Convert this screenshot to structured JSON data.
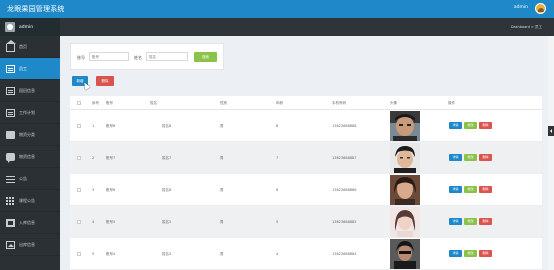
{
  "app": {
    "title": "龙眼果园管理系统",
    "user_name": "admin"
  },
  "sidebar": {
    "user_label": "admin",
    "items": [
      {
        "label": "首页",
        "icon": "home-icon"
      },
      {
        "label": "员工",
        "icon": "document-icon",
        "active": true
      },
      {
        "label": "园田信息",
        "icon": "document-icon"
      },
      {
        "label": "工作计划",
        "icon": "document-icon"
      },
      {
        "label": "物资分类",
        "icon": "bag-icon"
      },
      {
        "label": "物资信息",
        "icon": "chat-icon"
      },
      {
        "label": "公告",
        "icon": "list-icon"
      },
      {
        "label": "课程公告",
        "icon": "grid-icon"
      },
      {
        "label": "入库信息",
        "icon": "film-icon"
      },
      {
        "label": "出库信息",
        "icon": "image-icon"
      }
    ]
  },
  "breadcrumb": "Dashboard > 员工",
  "search": {
    "account_label": "账号",
    "account_placeholder": "账号",
    "name_label": "姓名",
    "name_placeholder": "姓名",
    "button": "搜索"
  },
  "toolbar": {
    "add_label": "新增",
    "delete_label": "删除"
  },
  "table": {
    "headers": [
      "序号",
      "账号",
      "姓名",
      "性别",
      "年龄",
      "手机号码",
      "头像",
      "操作"
    ],
    "rows": [
      {
        "index": "1",
        "account": "账号8",
        "name": "姓名8",
        "gender": "男",
        "age": "8",
        "phone": "13823888888"
      },
      {
        "index": "2",
        "account": "账号7",
        "name": "姓名7",
        "gender": "男",
        "age": "7",
        "phone": "13823888887"
      },
      {
        "index": "3",
        "account": "账号6",
        "name": "姓名6",
        "gender": "男",
        "age": "6",
        "phone": "13823888886"
      },
      {
        "index": "4",
        "account": "账号5",
        "name": "姓名5",
        "gender": "男",
        "age": "5",
        "phone": "13823888885"
      },
      {
        "index": "5",
        "account": "账号4",
        "name": "姓名4",
        "gender": "男",
        "age": "4",
        "phone": "13823888884"
      }
    ],
    "actions": {
      "view": "详情",
      "edit": "修改",
      "delete": "删除"
    }
  },
  "colors": {
    "primary": "#1e88c9",
    "success": "#8bc34a",
    "danger": "#d9534f",
    "sidebar": "#2b3035"
  }
}
